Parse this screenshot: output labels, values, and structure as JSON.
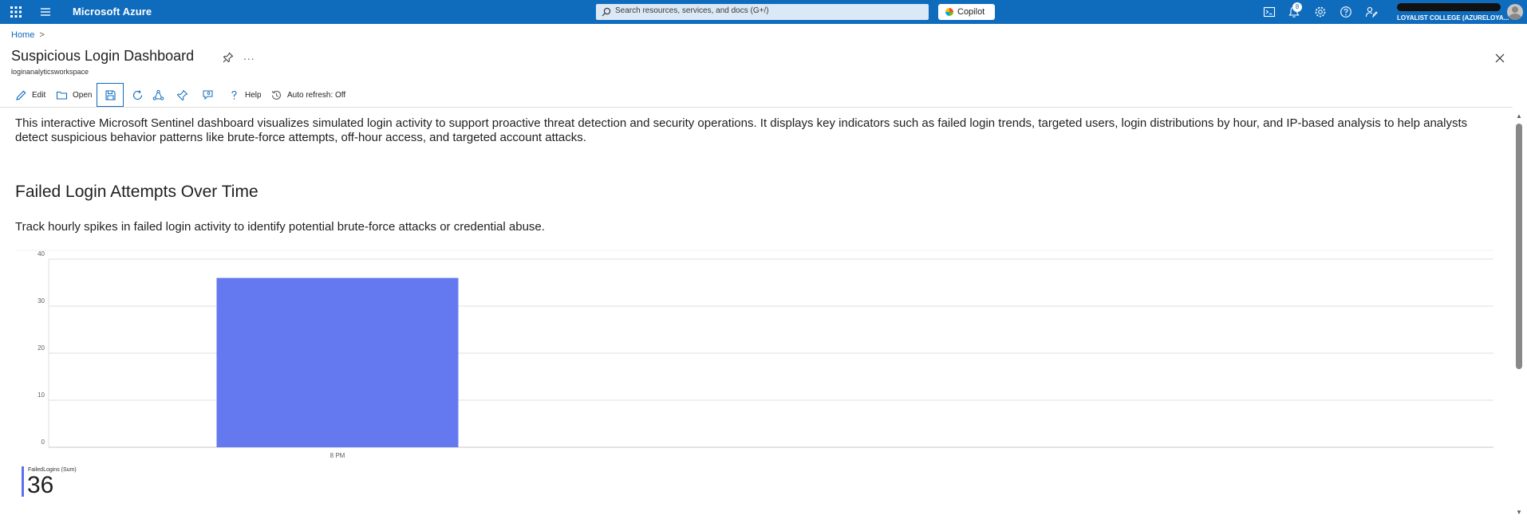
{
  "topbar": {
    "brand": "Microsoft Azure",
    "search_placeholder": "Search resources, services, and docs (G+/)",
    "copilot_label": "Copilot",
    "notification_count": "8",
    "account_org": "LOYALIST COLLEGE (AZURELOYA..."
  },
  "breadcrumb": {
    "home": "Home",
    "separator": ">"
  },
  "page": {
    "title": "Suspicious Login Dashboard",
    "subtitle": "loginanalyticsworkspace",
    "more": "..."
  },
  "toolbar": {
    "edit": "Edit",
    "open": "Open",
    "help": "Help",
    "auto_refresh": "Auto refresh: Off"
  },
  "content": {
    "description": "This interactive Microsoft Sentinel dashboard visualizes simulated login activity to support proactive threat detection and security operations. It displays key indicators such as failed login trends, targeted users, login distributions by hour, and IP-based analysis to help analysts detect suspicious behavior patterns like brute-force attempts, off-hour access, and targeted account attacks.",
    "section_title": "Failed Login Attempts Over Time",
    "section_subtitle": "Track hourly spikes in failed login activity to identify potential brute-force attacks or credential abuse."
  },
  "chart_data": {
    "type": "bar",
    "categories": [
      "8 PM"
    ],
    "values": [
      36
    ],
    "ylim": [
      0,
      40
    ],
    "yticks": [
      0,
      10,
      20,
      30,
      40
    ],
    "grid": true,
    "color": "#6479f0",
    "series": [
      {
        "name": "FailedLogins (Sum)",
        "values": [
          36
        ]
      }
    ]
  },
  "kpi": {
    "label": "FailedLogins (Sum)",
    "value": "36"
  },
  "colors": {
    "azure_blue": "#0f6cbd",
    "bar": "#6479f0"
  }
}
